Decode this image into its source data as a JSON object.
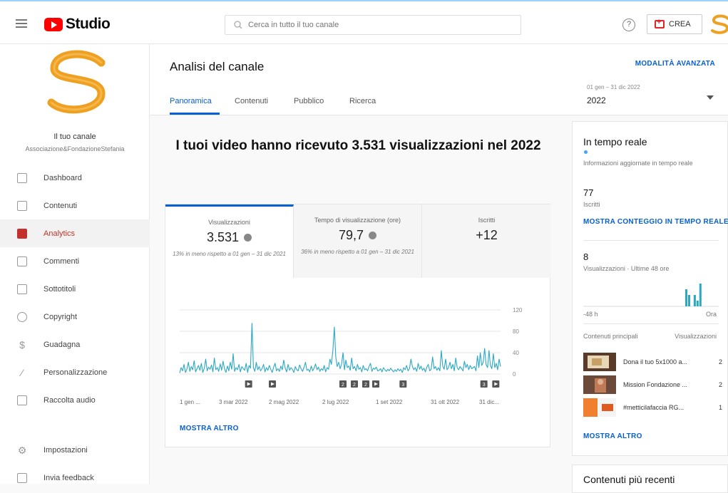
{
  "app": {
    "name": "Studio"
  },
  "search": {
    "placeholder": "Cerca in tutto il tuo canale"
  },
  "header": {
    "create_label": "CREA",
    "help": "?"
  },
  "channel": {
    "title": "Il tuo canale",
    "name": "Associazione&FondazioneStefania"
  },
  "sidebar": {
    "items": [
      {
        "label": "Dashboard",
        "icon": "dashboard-icon"
      },
      {
        "label": "Contenuti",
        "icon": "content-icon"
      },
      {
        "label": "Analytics",
        "icon": "analytics-icon",
        "active": true
      },
      {
        "label": "Commenti",
        "icon": "comments-icon"
      },
      {
        "label": "Sottotitoli",
        "icon": "subtitles-icon"
      },
      {
        "label": "Copyright",
        "icon": "copyright-icon"
      },
      {
        "label": "Guadagna",
        "icon": "dollar-icon"
      },
      {
        "label": "Personalizzazione",
        "icon": "magic-wand-icon"
      },
      {
        "label": "Raccolta audio",
        "icon": "audio-library-icon"
      },
      {
        "label": "Impostazioni",
        "icon": "gear-icon"
      },
      {
        "label": "Invia feedback",
        "icon": "feedback-icon"
      }
    ]
  },
  "page": {
    "title": "Analisi del canale",
    "advanced_mode": "MODALITÀ AVANZATA",
    "tabs": [
      "Panoramica",
      "Contenuti",
      "Pubblico",
      "Ricerca"
    ],
    "date_range_label": "01 gen – 31 dic 2022",
    "date_range_value": "2022",
    "headline": "I tuoi video hanno ricevuto 3.531 visualizzazioni nel 2022"
  },
  "metrics": [
    {
      "label": "Visualizzazioni",
      "value": "3.531",
      "comparison": "13% in meno rispetto a 01 gen – 31 dic 2021"
    },
    {
      "label": "Tempo di visualizzazione (ore)",
      "value": "79,7",
      "comparison": "36% in meno rispetto a 01 gen – 31 dic 2021"
    },
    {
      "label": "Iscritti",
      "value": "+12",
      "comparison": ""
    }
  ],
  "overview": {
    "show_more": "MOSTRA ALTRO"
  },
  "chart_data": {
    "type": "line",
    "y_ticks": [
      "120",
      "80",
      "40",
      "0"
    ],
    "ylim": [
      0,
      120
    ],
    "x_tick_labels": [
      "1 gen ...",
      "3 mar 2022",
      "2 mag 2022",
      "2 lug 2022",
      "1 set 2022",
      "31 ott 2022",
      "31 dic..."
    ],
    "series": [
      {
        "color": "#2aa8c4",
        "values": [
          2,
          12,
          6,
          18,
          3,
          9,
          22,
          5,
          14,
          8,
          25,
          4,
          10,
          16,
          7,
          20,
          3,
          11,
          28,
          6,
          13,
          9,
          17,
          4,
          30,
          8,
          12,
          5,
          19,
          7,
          24,
          10,
          3,
          15,
          6,
          22,
          9,
          38,
          5,
          12,
          8,
          18,
          4,
          14,
          10,
          7,
          20,
          3,
          16,
          11,
          95,
          12,
          5,
          22,
          8,
          14,
          6,
          10,
          18,
          4,
          12,
          7,
          16,
          9,
          3,
          13,
          20,
          6,
          10,
          5,
          15,
          8,
          26,
          11,
          4,
          18,
          7,
          12,
          9,
          3,
          14,
          8,
          6,
          17,
          10,
          5,
          12,
          22,
          7,
          9,
          4,
          15,
          6,
          11,
          19,
          8,
          13,
          5,
          10,
          7,
          16,
          4,
          12,
          9,
          28,
          18,
          45,
          88,
          32,
          14,
          22,
          10,
          18,
          40,
          8,
          26,
          12,
          15,
          7,
          30,
          10,
          14,
          6,
          18,
          9,
          12,
          4,
          16,
          8,
          10,
          6,
          14,
          20,
          5,
          11,
          9,
          13,
          6,
          7,
          10,
          4,
          12,
          8,
          5,
          9,
          6,
          11,
          7,
          4,
          8,
          5,
          10,
          6,
          9,
          3,
          12,
          8,
          16,
          6,
          10,
          28,
          14,
          8,
          12,
          5,
          20,
          9,
          15,
          7,
          11,
          4,
          13,
          18,
          6,
          9,
          32,
          10,
          14,
          7,
          12,
          6,
          44,
          15,
          9,
          28,
          8,
          12,
          22,
          10,
          18,
          6,
          30,
          12,
          8,
          14,
          10,
          6,
          24,
          12,
          18,
          8,
          16,
          10,
          12,
          14,
          6,
          34,
          12,
          40,
          16,
          22,
          48,
          18,
          12,
          44,
          16,
          10,
          38,
          12,
          20,
          8,
          28,
          14
        ]
      }
    ],
    "markers": [
      {
        "pos": 0.29,
        "kind": "play"
      },
      {
        "pos": 0.39,
        "kind": "play"
      },
      {
        "pos": 0.687,
        "kind": "count",
        "label": "2"
      },
      {
        "pos": 0.735,
        "kind": "count",
        "label": "2"
      },
      {
        "pos": 0.783,
        "kind": "count",
        "label": "2"
      },
      {
        "pos": 0.825,
        "kind": "play"
      },
      {
        "pos": 0.94,
        "kind": "count",
        "label": "3"
      },
      {
        "pos": 1.28,
        "kind": "count",
        "label": "3"
      },
      {
        "pos": 1.33,
        "kind": "play"
      }
    ]
  },
  "realtime": {
    "title": "In tempo reale",
    "subtitle": "Informazioni aggiornate in tempo reale",
    "subscribers": "77",
    "subscribers_label": "Iscritti",
    "live_count_link": "MOSTRA CONTEGGIO IN TEMPO REALE",
    "views": "8",
    "views_label": "Visualizzazioni · Ultime 48 ore",
    "axis_left": "-48 h",
    "axis_right": "Ora",
    "top_content": "Contenuti principali",
    "views_col": "Visualizzazioni",
    "videos": [
      {
        "title": "Dona il tuo 5x1000 a...",
        "views": "2"
      },
      {
        "title": "Mission Fondazione ...",
        "views": "2"
      },
      {
        "title": "#metticilafaccia RG...",
        "views": "1"
      }
    ],
    "show_more": "MOSTRA ALTRO",
    "bars": [
      0,
      0,
      0,
      0,
      0,
      0,
      0,
      0,
      0,
      0,
      0,
      0,
      0,
      0,
      0,
      0,
      0,
      0,
      0,
      0,
      0,
      0,
      0,
      0,
      0,
      0,
      0,
      0,
      0,
      0,
      0,
      0,
      0,
      0,
      0,
      0,
      3,
      2,
      0,
      2,
      1,
      4,
      0,
      0,
      0,
      0,
      0,
      0
    ]
  },
  "recent": {
    "title": "Contenuti più recenti"
  }
}
